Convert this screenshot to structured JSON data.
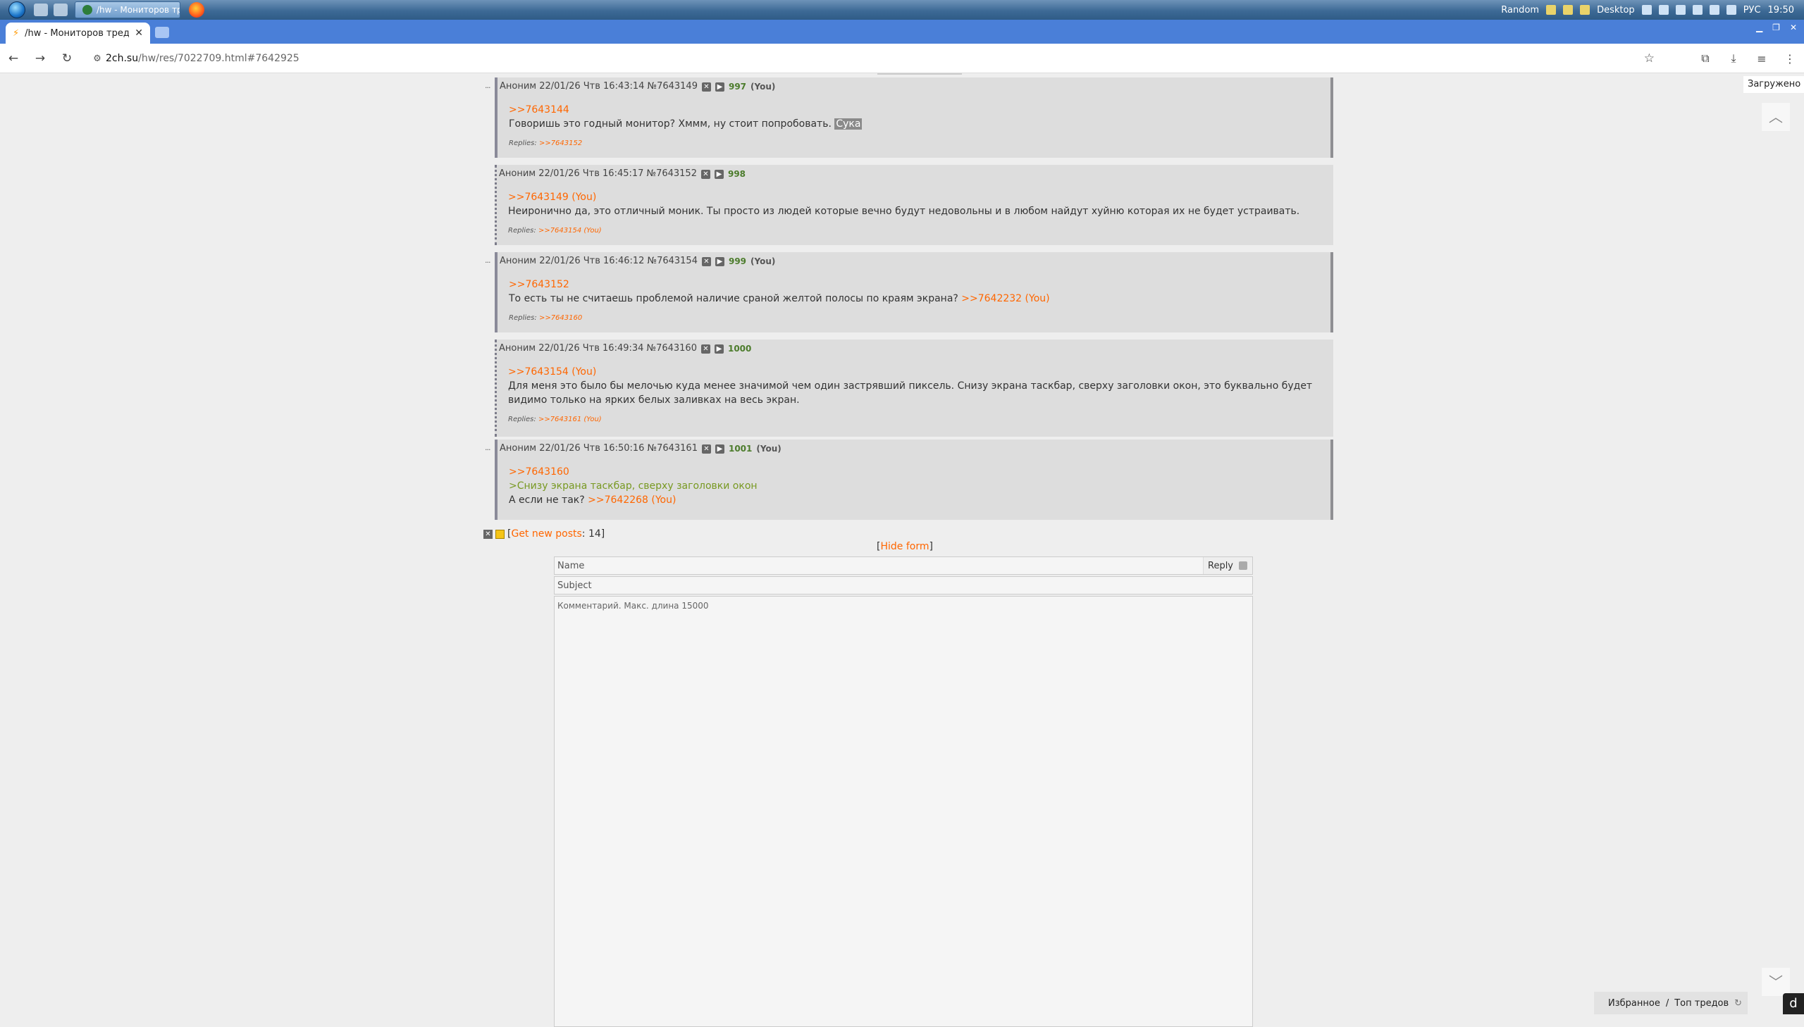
{
  "taskbar": {
    "task_title": "/hw - Мониторов тр...",
    "tray": {
      "random_label": "Random",
      "desktop_label": "Desktop",
      "lang": "РУС",
      "time": "19:50"
    }
  },
  "browser": {
    "tab_title": "/hw - Мониторов тред /",
    "address_host": "2ch.su",
    "address_path": "/hw/res/7022709.html#7642925"
  },
  "posts": [
    {
      "header": "Аноним 22/01/26 Чтв 16:43:14 №7643149",
      "num": "997",
      "you": "(You)",
      "ref": ">>7643144",
      "text": "Говоришь это годный монитор? Хммм, ну стоит попробовать.",
      "highlight": "Сука",
      "replies_label": "Replies:",
      "replies": ">>7643152"
    },
    {
      "header": "Аноним 22/01/26 Чтв 16:45:17 №7643152",
      "num": "998",
      "ref": ">>7643149 (You)",
      "text": "Неиронично да, это отличный моник. Ты просто из людей которые вечно будут недовольны и в любом найдут хуйню которая их не будет устраивать.",
      "replies_label": "Replies:",
      "replies": ">>7643154 (You)"
    },
    {
      "header": "Аноним 22/01/26 Чтв 16:46:12 №7643154",
      "num": "999",
      "you": "(You)",
      "ref": ">>7643152",
      "text": "То есть ты не считаешь проблемой наличие сраной желтой полосы по краям экрана?",
      "inline_ref": ">>7642232 (You)",
      "replies_label": "Replies:",
      "replies": ">>7643160"
    },
    {
      "header": "Аноним 22/01/26 Чтв 16:49:34 №7643160",
      "num": "1000",
      "ref": ">>7643154 (You)",
      "text": "Для меня это было бы мелочью куда менее значимой чем один застрявший пиксель. Снизу экрана таскбар, сверху заголовки окон, это буквально будет видимо только на ярких белых заливках на весь экран.",
      "replies_label": "Replies:",
      "replies": ">>7643161 (You)"
    },
    {
      "header": "Аноним 22/01/26 Чтв 16:50:16 №7643161",
      "num": "1001",
      "you": "(You)",
      "ref": ">>7643160",
      "quote": ">Снизу экрана таскбар, сверху заголовки окон",
      "text": "А если не так?",
      "inline_ref": ">>7642268 (You)"
    }
  ],
  "thread_controls": {
    "get_new_label": "Get new posts",
    "get_new_count": ": 14]",
    "hide_form_label": "Hide form"
  },
  "form": {
    "name_placeholder": "Name",
    "subject_placeholder": "Subject",
    "comment_placeholder": "Комментарий. Макс. длина 15000",
    "reply_button": "Reply"
  },
  "sidebar": {
    "loaded_label": "Загружено",
    "favorites_label": "Избранное",
    "separator": "/",
    "top_threads_label": "Топ тредов"
  }
}
